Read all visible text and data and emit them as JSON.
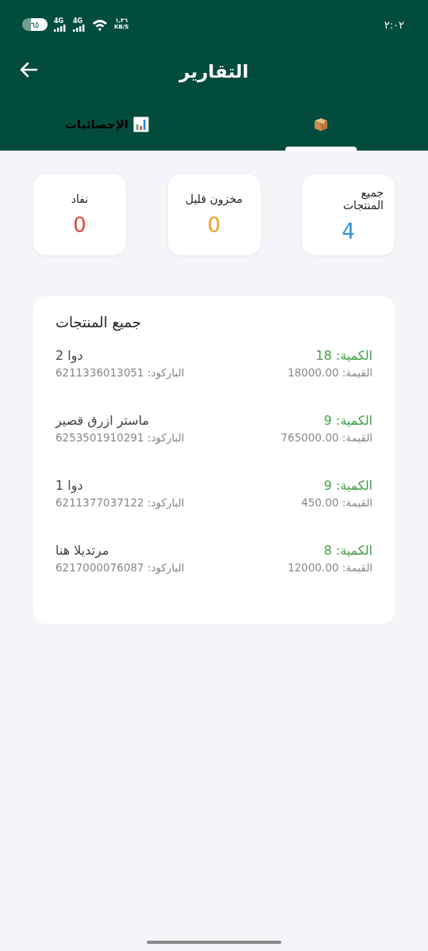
{
  "status_bar": {
    "time": "٢:٠٢",
    "battery": "٦٥",
    "networks": [
      "4G",
      "4G"
    ],
    "speed": "١,٣٦",
    "speed_unit": "KB/S"
  },
  "header": {
    "title": "التقارير"
  },
  "tabs": [
    {
      "kind": "box",
      "selected": true
    },
    {
      "kind": "chart",
      "label": "الإحصائيات",
      "selected": false
    }
  ],
  "stats": [
    {
      "label": "جميع المنتجات",
      "value": "4",
      "color": "#2e8fdc"
    },
    {
      "label": "مخزون قليل",
      "value": "0",
      "color": "#f0a020"
    },
    {
      "label": "نفاد",
      "value": "0",
      "color": "#e0463c"
    }
  ],
  "products": {
    "title": "جميع المنتجات",
    "items": [
      {
        "name": "دوا 2",
        "barcode": "الباركود: 6211336013051",
        "quantity": "الكمية: 18",
        "value": "القيمة: 18000.00"
      },
      {
        "name": "ماستر ازرق قصير",
        "barcode": "الباركود: 6253501910291",
        "quantity": "الكمية: 9",
        "value": "القيمة: 765000.00"
      },
      {
        "name": "دوا 1",
        "barcode": "الباركود: 6211377037122",
        "quantity": "الكمية: 9",
        "value": "القيمة: 450.00"
      },
      {
        "name": "مرتديلا هنا",
        "barcode": "الباركود: 6217000076087",
        "quantity": "الكمية: 8",
        "value": "القيمة: 12000.00"
      }
    ]
  }
}
